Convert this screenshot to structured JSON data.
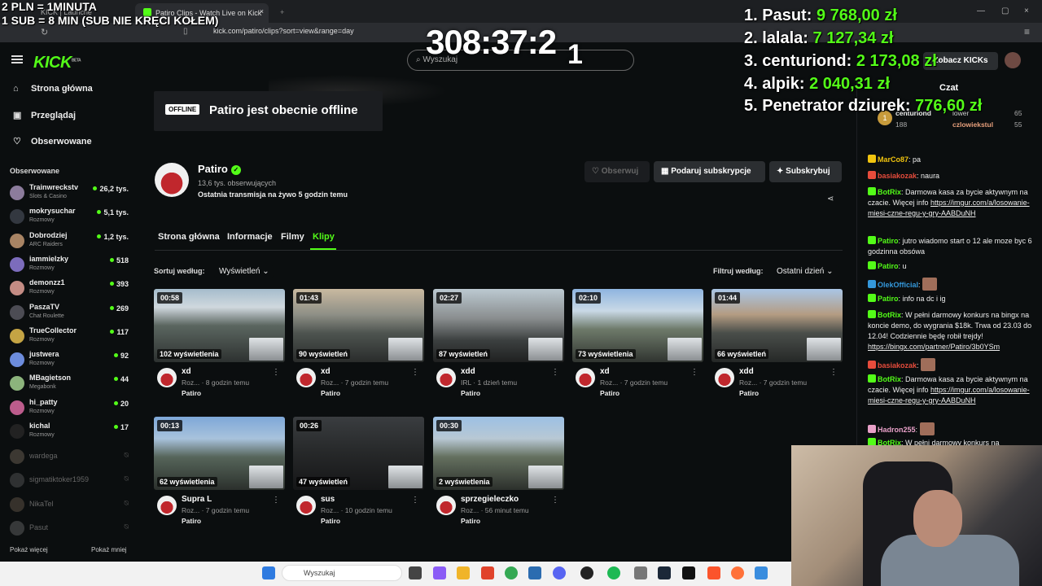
{
  "browser": {
    "tab_inactive": "KICK | Launche",
    "tab_active": "Patiro Clips - Watch Live on Kick",
    "url": "kick.com/patiro/clips?sort=view&range=day"
  },
  "overlay": {
    "line1": "2 PLN = 1MINUTA",
    "line2": "1 SUB = 8 MIN (SUB NIE KRĘCI KOŁEM)",
    "timer": "308:37:2",
    "timer_digit": "1",
    "leaderboard": [
      {
        "rank": "1.",
        "name": "Pasut:",
        "amount": "9 768,00 zł"
      },
      {
        "rank": "2.",
        "name": "lalala:",
        "amount": "7 127,34 zł"
      },
      {
        "rank": "3.",
        "name": "centuriond:",
        "amount": "2 173,08 zł"
      },
      {
        "rank": "4.",
        "name": "alpik:",
        "amount": "2 040,31 zł"
      },
      {
        "rank": "5.",
        "name": "Penetrator dziurek:",
        "amount": "776,60 zł"
      }
    ]
  },
  "header": {
    "logo": "KICK",
    "logo_beta": "BETA",
    "search_placeholder": "Wyszukaj",
    "login": "Zobacz KICKs"
  },
  "sidebar": {
    "nav": [
      {
        "icon": "⌂",
        "label": "Strona główna"
      },
      {
        "icon": "▣",
        "label": "Przeglądaj"
      },
      {
        "icon": "♡",
        "label": "Obserwowane"
      }
    ],
    "section": "Obserwowane",
    "followed": [
      {
        "name": "Trainwreckstv",
        "category": "Slots & Casino",
        "viewers": "26,2 tys.",
        "color": "#8c7c9c"
      },
      {
        "name": "mokrysuchar",
        "category": "Rozmowy",
        "viewers": "5,1 tys.",
        "color": "#333840"
      },
      {
        "name": "Dobrodziej",
        "category": "ARC Raiders",
        "viewers": "1,2 tys.",
        "color": "#a88464"
      },
      {
        "name": "iammielzky",
        "category": "Rozmowy",
        "viewers": "518",
        "color": "#7c6cbc"
      },
      {
        "name": "demonzz1",
        "category": "Rozmowy",
        "viewers": "393",
        "color": "#c48c84"
      },
      {
        "name": "PaszaTV",
        "category": "Chat Roulette",
        "viewers": "269",
        "color": "#4c4c54"
      },
      {
        "name": "TrueCollector",
        "category": "Rozmowy",
        "viewers": "117",
        "color": "#c4a444"
      },
      {
        "name": "justwera",
        "category": "Rozmowy",
        "viewers": "92",
        "color": "#6c8cdc"
      },
      {
        "name": "MBagietson",
        "category": "Megabonk",
        "viewers": "44",
        "color": "#8cb47c"
      },
      {
        "name": "hi_patty",
        "category": "Rozmowy",
        "viewers": "20",
        "color": "#bc5c8c"
      },
      {
        "name": "kichal",
        "category": "Rozmowy",
        "viewers": "17",
        "color": "#222222"
      }
    ],
    "offline": [
      {
        "name": "wardega",
        "color": "#887766"
      },
      {
        "name": "sigmatiktoker1959",
        "color": "#666666"
      },
      {
        "name": "NikaTel",
        "color": "#776655"
      },
      {
        "name": "Pasut",
        "color": "#777777"
      }
    ],
    "show_more": "Pokaż więcej",
    "show_less": "Pokaż mniej"
  },
  "channel": {
    "offline_badge": "OFFLINE",
    "offline_text": "Patiro jest obecnie offline",
    "name": "Patiro",
    "followers": "13,6 tys. obserwujących",
    "last_live": "Ostatnia transmisja na żywo 5 godzin temu",
    "btn_follow": "Obserwuj",
    "btn_gift": "Podaruj subskrypcje",
    "btn_sub": "Subskrybuj",
    "tabs": [
      "Strona główna",
      "Informacje",
      "Filmy",
      "Klipy"
    ],
    "sort_label": "Sortuj według:",
    "sort_value": "Wyświetleń",
    "filter_label": "Filtruj według:",
    "filter_value": "Ostatni dzień"
  },
  "clips": [
    {
      "duration": "00:58",
      "views": "102 wyświetlenia",
      "title": "xd",
      "category": "Roz...",
      "time": "8 godzin temu",
      "channel": "Patiro"
    },
    {
      "duration": "01:43",
      "views": "90 wyświetleń",
      "title": "xd",
      "category": "Roz...",
      "time": "7 godzin temu",
      "channel": "Patiro"
    },
    {
      "duration": "02:27",
      "views": "87 wyświetleń",
      "title": "xdd",
      "category": "IRL",
      "time": "1 dzień temu",
      "channel": "Patiro"
    },
    {
      "duration": "02:10",
      "views": "73 wyświetlenia",
      "title": "xd",
      "category": "Roz...",
      "time": "7 godzin temu",
      "channel": "Patiro"
    },
    {
      "duration": "01:44",
      "views": "66 wyświetleń",
      "title": "xdd",
      "category": "Roz...",
      "time": "7 godzin temu",
      "channel": "Patiro"
    },
    {
      "duration": "00:13",
      "views": "62 wyświetlenia",
      "title": "Supra L",
      "category": "Roz...",
      "time": "7 godzin temu",
      "channel": "Patiro"
    },
    {
      "duration": "00:26",
      "views": "47 wyświetleń",
      "title": "sus",
      "category": "Roz...",
      "time": "10 godzin temu",
      "channel": "Patiro"
    },
    {
      "duration": "00:30",
      "views": "2 wyświetlenia",
      "title": "sprzegieleczko",
      "category": "Roz...",
      "time": "56 minut temu",
      "channel": "Patiro"
    }
  ],
  "chat": {
    "title": "Czat",
    "pinned": [
      {
        "name": "centuriond",
        "value": "188"
      },
      {
        "name": "lower",
        "value": "65"
      },
      {
        "name": "czlowiekstul",
        "value": "55"
      }
    ],
    "messages": [
      {
        "user": "MarCo87",
        "color": "#f1c40f",
        "text": "pa"
      },
      {
        "user": "basiakozak",
        "color": "#e74c3c",
        "text": "naura"
      },
      {
        "user": "BotRix",
        "color": "#53fc18",
        "text": "Darmowa kasa za bycie aktywnym na czacie. Więcej info",
        "link": "https://imgur.com/a/losowanie-miesi-czne-regu-y-gry-AABDuNH"
      },
      {
        "user": "Patiro",
        "color": "#53fc18",
        "text": "jutro wiadomo start o 12 ale moze byc 6 godzinna obsówa"
      },
      {
        "user": "Patiro",
        "color": "#53fc18",
        "text": "u"
      },
      {
        "user": "OlekOfficial",
        "color": "#3498db",
        "text": ""
      },
      {
        "user": "Patiro",
        "color": "#53fc18",
        "text": "info na dc i ig"
      },
      {
        "user": "BotRix",
        "color": "#53fc18",
        "text": "W pełni darmowy konkurs na bingx na koncie demo, do wygrania $18k. Trwa od 23.03 do 12.04! Codziennie będę robił trejdy!",
        "link": "https://bingx.com/partner/Patiro/3b0YSm"
      },
      {
        "user": "basiakozak",
        "color": "#e74c3c",
        "text": ""
      },
      {
        "user": "BotRix",
        "color": "#53fc18",
        "text": "Darmowa kasa za bycie aktywnym na czacie. Więcej info",
        "link": "https://imgur.com/a/losowanie-miesi-czne-regu-y-gry-AABDuNH"
      },
      {
        "user": "Hadron255",
        "color": "#e8a0c8",
        "text": ""
      },
      {
        "user": "BotRix",
        "color": "#53fc18",
        "text": "W pełni darmowy konkurs na"
      }
    ]
  },
  "taskbar": {
    "search": "Wyszukaj"
  }
}
